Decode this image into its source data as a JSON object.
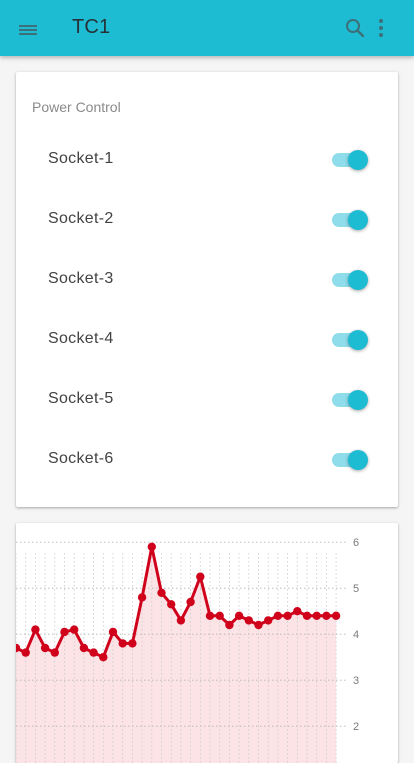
{
  "appbar": {
    "title": "TC1",
    "background": "#1ebcd3",
    "menu_icon": "hamburger-menu-icon",
    "search_icon": "search-icon",
    "more_icon": "more-vert-icon"
  },
  "power_control": {
    "title": "Power Control",
    "accent": "#1ebcd3",
    "sockets": [
      {
        "label": "Socket-1",
        "on": true
      },
      {
        "label": "Socket-2",
        "on": true
      },
      {
        "label": "Socket-3",
        "on": true
      },
      {
        "label": "Socket-4",
        "on": true
      },
      {
        "label": "Socket-5",
        "on": true
      },
      {
        "label": "Socket-6",
        "on": true
      }
    ]
  },
  "chart_data": {
    "type": "area",
    "line_color": "#d0021b",
    "fill_color": "#fbe3e6",
    "grid": true,
    "y_axis_position": "right",
    "ylim": [
      1.2,
      6.2
    ],
    "y_ticks": [
      2,
      3,
      4,
      5,
      6
    ],
    "series": [
      {
        "values": [
          3.7,
          3.6,
          4.1,
          3.7,
          3.6,
          4.05,
          4.1,
          3.7,
          3.6,
          3.5,
          4.05,
          3.8,
          3.8,
          4.8,
          5.9,
          4.9,
          4.65,
          4.3,
          4.7,
          5.25,
          4.4,
          4.4,
          4.2,
          4.4,
          4.3,
          4.2,
          4.3,
          4.4,
          4.4,
          4.5,
          4.4,
          4.4,
          4.4,
          4.4
        ]
      }
    ]
  }
}
